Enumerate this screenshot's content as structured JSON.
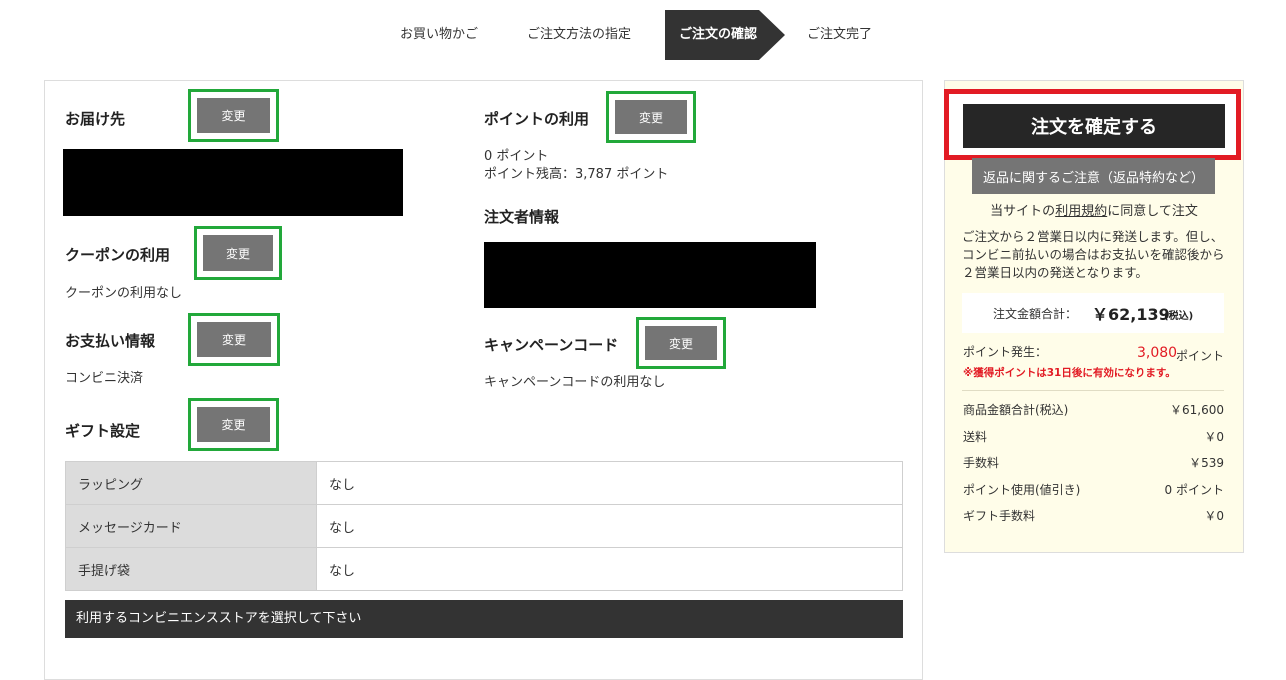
{
  "steps": {
    "cart": "お買い物かご",
    "method": "ご注文方法の指定",
    "confirm": "ご注文の確認",
    "complete": "ご注文完了"
  },
  "change_label": "変更",
  "delivery": {
    "title": "お届け先"
  },
  "coupon": {
    "title": "クーポンの利用",
    "value": "クーポンの利用なし"
  },
  "payment": {
    "title": "お支払い情報",
    "value": "コンビニ決済"
  },
  "gift": {
    "title": "ギフト設定",
    "rows": [
      {
        "label": "ラッピング",
        "value": "なし"
      },
      {
        "label": "メッセージカード",
        "value": "なし"
      },
      {
        "label": "手提げ袋",
        "value": "なし"
      }
    ]
  },
  "store_bar": "利用するコンビニエンスストアを選択して下さい",
  "points": {
    "title": "ポイントの利用",
    "used": "0 ポイント",
    "balance": "ポイント残高：3,787 ポイント"
  },
  "orderer": {
    "title": "注文者情報"
  },
  "campaign": {
    "title": "キャンペーンコード",
    "value": "キャンペーンコードの利用なし"
  },
  "side": {
    "confirm_button": "注文を確定する",
    "return_button": "返品に関するご注意（返品特約など）",
    "agree_prefix": "当サイトの",
    "agree_link": "利用規約",
    "agree_suffix": "に同意して注文",
    "shipping_note": "ご注文から２営業日以内に発送します。但し、コンビニ前払いの場合はお支払いを確認後から２営業日以内の発送となります。",
    "total_label": "注文金額合計：",
    "total_value": "￥62,139",
    "total_tax": "(税込)",
    "points_label": "ポイント発生：",
    "points_value": "3,080",
    "points_unit": "ポイント",
    "points_note": "※獲得ポイントは31日後に有効になります。",
    "breakdown": [
      {
        "label": "商品金額合計(税込)",
        "value": "￥61,600"
      },
      {
        "label": "送料",
        "value": "￥0"
      },
      {
        "label": "手数料",
        "value": "￥539"
      },
      {
        "label": "ポイント使用(値引き)",
        "value": "0 ポイント"
      },
      {
        "label": "ギフト手数料",
        "value": "￥0"
      }
    ]
  },
  "colors": {
    "highlight_green": "#22a83a",
    "highlight_red": "#e21b24",
    "points_red": "#e21b24"
  }
}
